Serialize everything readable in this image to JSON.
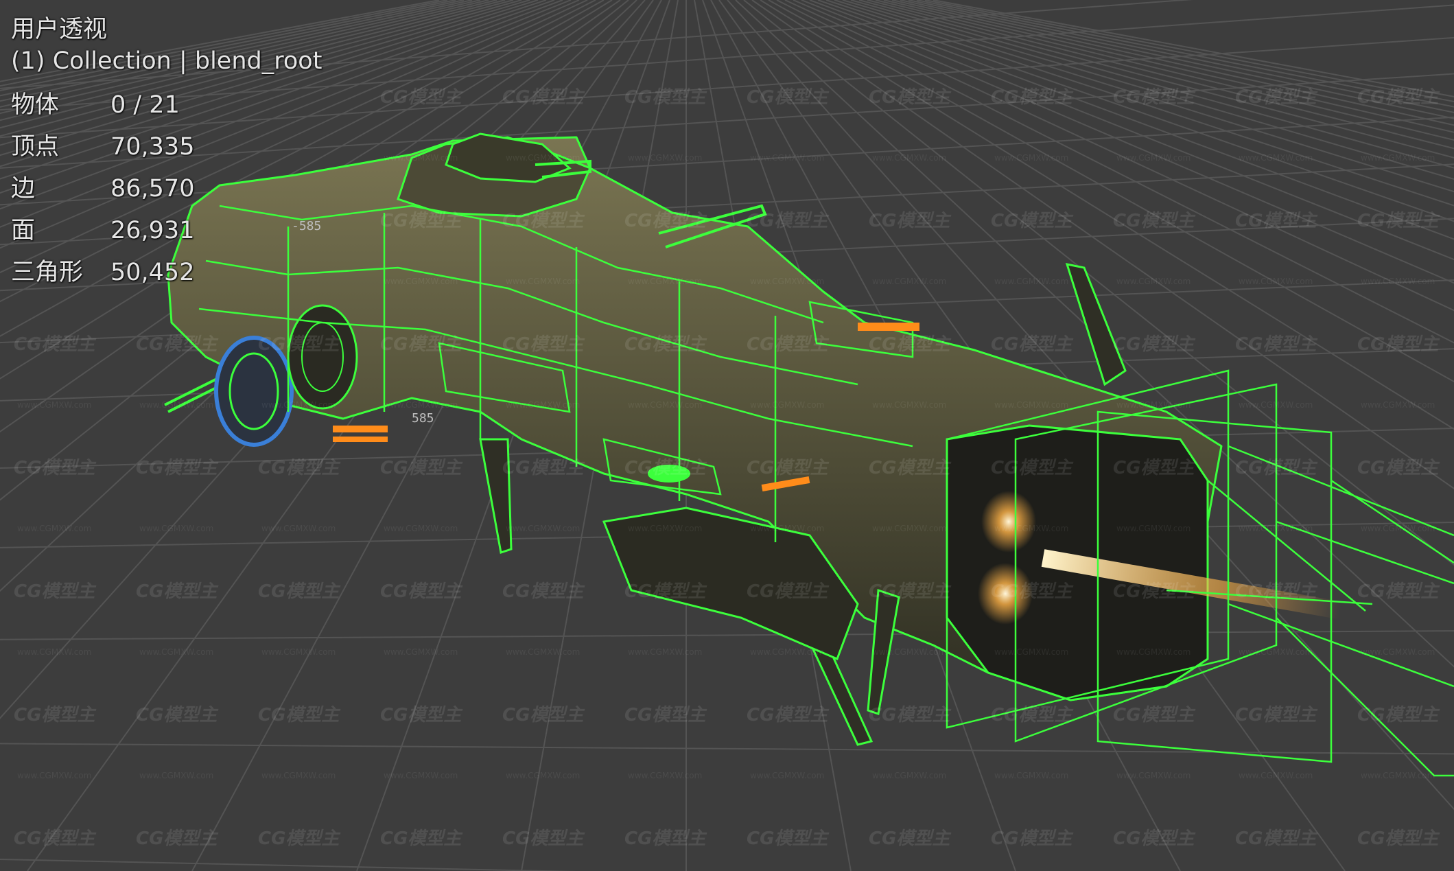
{
  "viewport": {
    "view_name": "用户透视",
    "collection_label": "(1) Collection | blend_root",
    "stats": [
      {
        "label": "物体",
        "value": "0 / 21"
      },
      {
        "label": "顶点",
        "value": "70,335"
      },
      {
        "label": "边",
        "value": "86,570"
      },
      {
        "label": "面",
        "value": "26,931"
      },
      {
        "label": "三角形",
        "value": "50,452"
      }
    ],
    "watermark_text": "CG模型主",
    "watermark_url": "www.CGMXW.com"
  },
  "colors": {
    "background": "#3d3d3d",
    "grid": "#545454",
    "wireframe": "#3cff3c",
    "hull": "#5a5a3c",
    "engine_glow": "#ffb347",
    "lights": "#ff8c1a",
    "blue_accent": "#3a7fd8"
  }
}
